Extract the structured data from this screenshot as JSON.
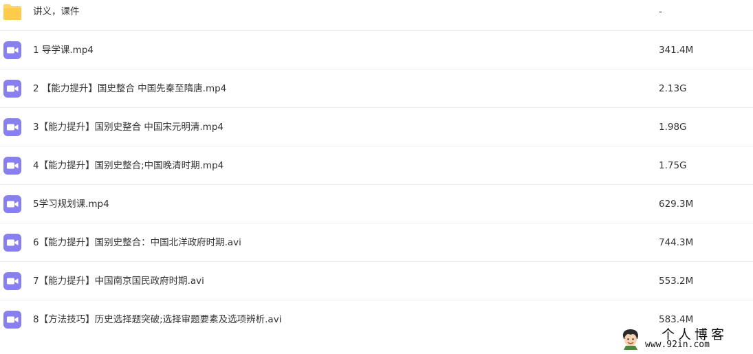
{
  "colors": {
    "folder": "#FFD667",
    "video": "#8A7FEF",
    "divider": "#EEEEEE",
    "text": "#333333"
  },
  "files": [
    {
      "icon": "folder-icon",
      "name": "讲义，课件",
      "size": "-"
    },
    {
      "icon": "video-file-icon",
      "name": "1 导学课.mp4",
      "size": "341.4M"
    },
    {
      "icon": "video-file-icon",
      "name": "2 【能力提升】国史整合 中国先秦至隋唐.mp4",
      "size": "2.13G"
    },
    {
      "icon": "video-file-icon",
      "name": "3【能力提升】国别史整合 中国宋元明清.mp4",
      "size": "1.98G"
    },
    {
      "icon": "video-file-icon",
      "name": "4【能力提升】国别史整合;中国晚清时期.mp4",
      "size": "1.75G"
    },
    {
      "icon": "video-file-icon",
      "name": "5学习规划课.mp4",
      "size": "629.3M"
    },
    {
      "icon": "video-file-icon",
      "name": "6【能力提升】国别史整合：中国北洋政府时期.avi",
      "size": "744.3M"
    },
    {
      "icon": "video-file-icon",
      "name": "7【能力提升】中国南京国民政府时期.avi",
      "size": "553.2M"
    },
    {
      "icon": "video-file-icon",
      "name": "8【方法技巧】历史选择题突破;选择审题要素及选项辨析.avi",
      "size": "583.4M"
    }
  ],
  "watermark": {
    "title": "个人博客",
    "url": "www.92in.com"
  }
}
